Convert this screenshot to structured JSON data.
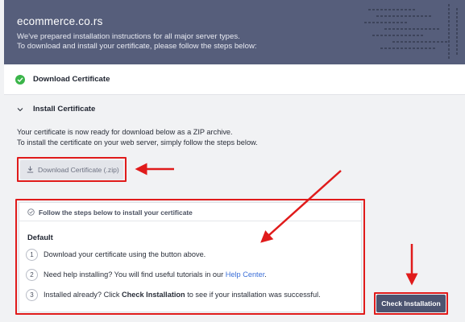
{
  "header": {
    "title": "ecommerce.co.rs",
    "desc_line1": "We've prepared installation instructions for all major server types.",
    "desc_line2": "To download and install your certificate, please follow the steps below:"
  },
  "steps": {
    "download": {
      "label": "Download Certificate",
      "status": "completed"
    },
    "install": {
      "label": "Install Certificate",
      "intro_line1": "Your certificate is now ready for download below as a ZIP archive.",
      "intro_line2": "To install the certificate on your web server, simply follow the steps below.",
      "download_button": "Download Certificate (.zip)"
    }
  },
  "instructions": {
    "heading": "Follow the steps below to install your certificate",
    "section": "Default",
    "items": [
      {
        "num": "1",
        "text": "Download your certificate using the button above."
      },
      {
        "num": "2",
        "text_before": "Need help installing? You will find useful tutorials in our ",
        "link": "Help Center",
        "text_after": "."
      },
      {
        "num": "3",
        "text_before": "Installed already? Click ",
        "strong": "Check Installation",
        "text_after": " to see if your installation was successful."
      }
    ]
  },
  "actions": {
    "check_installation": "Check Installation"
  },
  "colors": {
    "header_bg": "#565e7b",
    "success": "#3bb54a",
    "annotation": "#e01b1b",
    "link": "#3b6fd8",
    "primary_button": "#4c5470"
  }
}
